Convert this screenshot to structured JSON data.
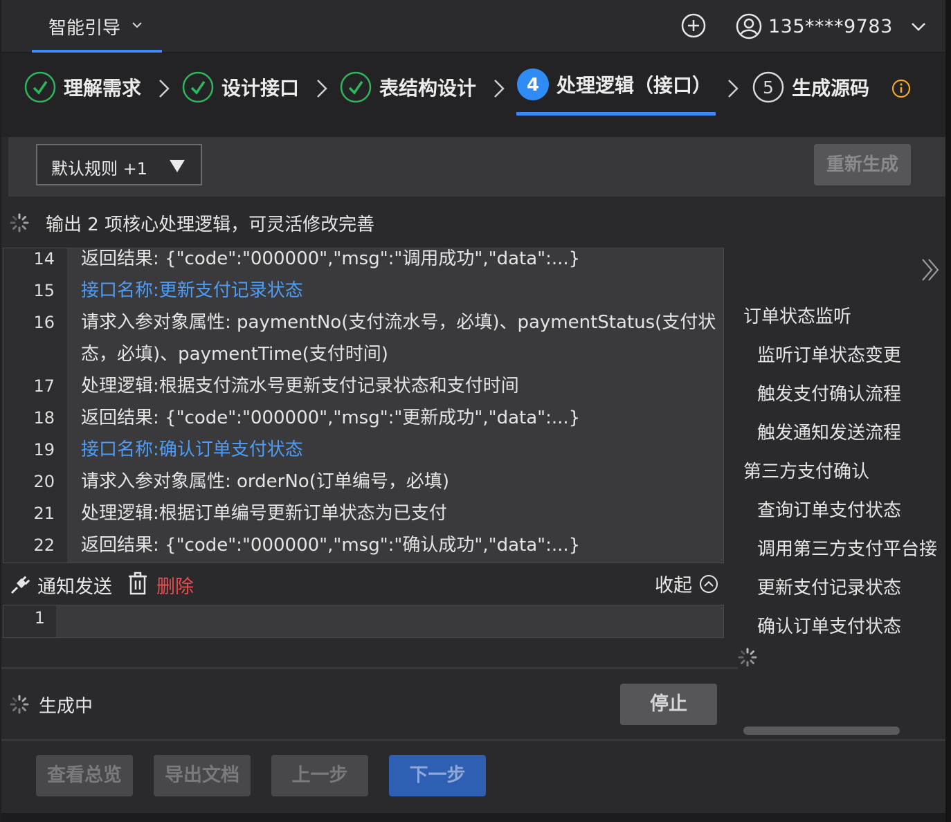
{
  "topbar": {
    "guide_label": "智能引导",
    "user_phone": "135****9783"
  },
  "steps": [
    {
      "label": "理解需求",
      "state": "done"
    },
    {
      "label": "设计接口",
      "state": "done"
    },
    {
      "label": "表结构设计",
      "state": "done"
    },
    {
      "label": "处理逻辑（接口）",
      "state": "active",
      "number": "4"
    },
    {
      "label": "生成源码",
      "state": "pending",
      "number": "5"
    }
  ],
  "rulebar": {
    "select_value": "默认规则 +1",
    "regen_label": "重新生成"
  },
  "status": {
    "output_text": "输出 2 项核心处理逻辑，可灵活修改完善"
  },
  "editor": {
    "lines": [
      {
        "num": "14",
        "text": "返回结果: {\"code\":\"000000\",\"msg\":\"调用成功\",\"data\":...}"
      },
      {
        "num": "15",
        "text": "接口名称:更新支付记录状态"
      },
      {
        "num": "16",
        "text": "请求入参对象属性: paymentNo(支付流水号，必填)、paymentStatus(支付状态，必填)、paymentTime(支付时间)"
      },
      {
        "num": "17",
        "text": "处理逻辑:根据支付流水号更新支付记录状态和支付时间"
      },
      {
        "num": "18",
        "text": "返回结果: {\"code\":\"000000\",\"msg\":\"更新成功\",\"data\":...}"
      },
      {
        "num": "19",
        "text": "接口名称:确认订单支付状态"
      },
      {
        "num": "20",
        "text": "请求入参对象属性: orderNo(订单编号，必填)"
      },
      {
        "num": "21",
        "text": "处理逻辑:根据订单编号更新订单状态为已支付"
      },
      {
        "num": "22",
        "text": "返回结果: {\"code\":\"000000\",\"msg\":\"确认成功\",\"data\":...}"
      }
    ]
  },
  "section": {
    "title": "通知发送",
    "delete_label": "删除",
    "collapse_label": "收起"
  },
  "editor2": {
    "lines": [
      {
        "num": "1",
        "text": ""
      }
    ]
  },
  "generation": {
    "status_text": "生成中",
    "stop_label": "停止"
  },
  "outline": {
    "items": [
      {
        "label": "订单状态监听",
        "level": 1
      },
      {
        "label": "监听订单状态变更",
        "level": 2
      },
      {
        "label": "触发支付确认流程",
        "level": 2
      },
      {
        "label": "触发通知发送流程",
        "level": 2
      },
      {
        "label": "第三方支付确认",
        "level": 1
      },
      {
        "label": "查询订单支付状态",
        "level": 2
      },
      {
        "label": "调用第三方支付平台接",
        "level": 2
      },
      {
        "label": "更新支付记录状态",
        "level": 2
      },
      {
        "label": "确认订单支付状态",
        "level": 2
      }
    ]
  },
  "footer": {
    "overview_label": "查看总览",
    "export_label": "导出文档",
    "prev_label": "上一步",
    "next_label": "下一步"
  },
  "colors": {
    "accent": "#3d86f5",
    "done_green": "#2fb55a",
    "info_orange": "#f5a623",
    "danger": "#f04a4a",
    "link_blue": "#4d9cf5"
  },
  "icons": [
    "chevron-down-icon",
    "plus-circle-icon",
    "user-icon",
    "check-circle-icon",
    "chevron-right-icon",
    "info-icon",
    "triangle-down-icon",
    "spinner-icon",
    "plug-icon",
    "trash-icon",
    "collapse-up-icon",
    "double-chevron-right-icon"
  ]
}
